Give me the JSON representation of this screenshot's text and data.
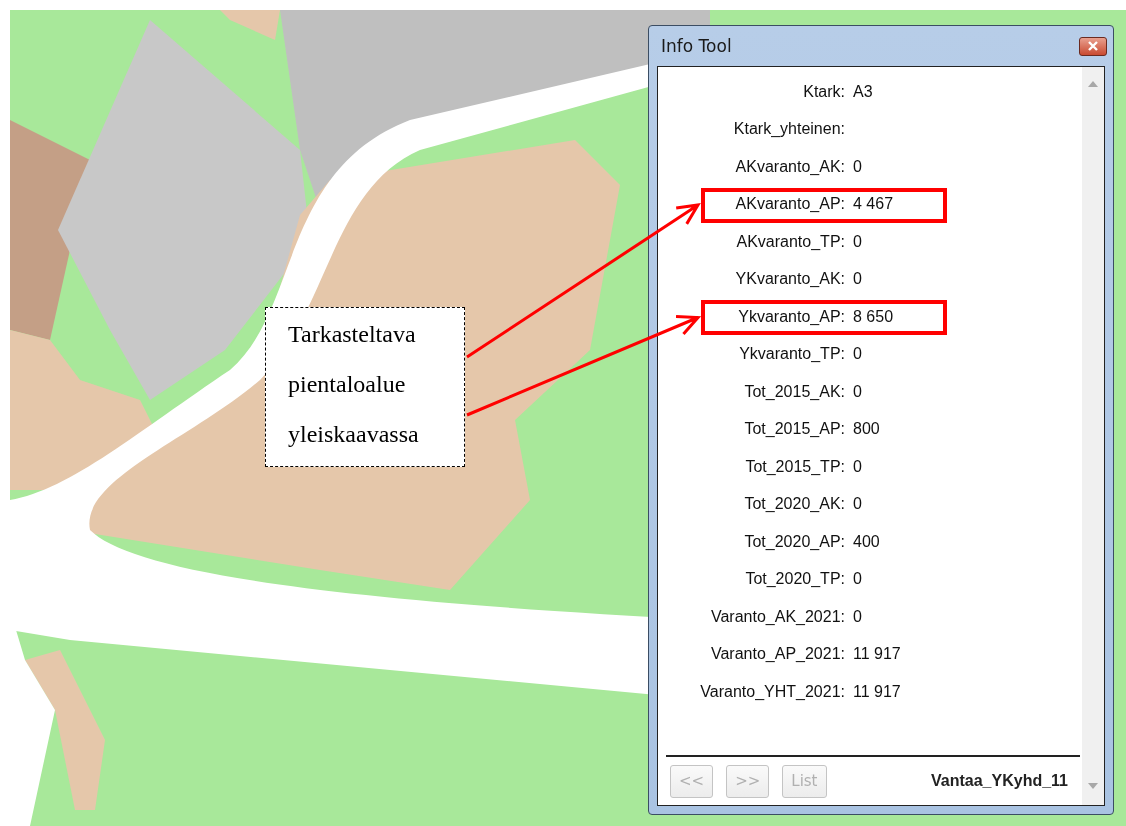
{
  "map_label": {
    "lines": [
      "Tarkasteltava",
      "pientaloalue",
      "yleiskaavassa"
    ]
  },
  "window": {
    "title": "Info Tool",
    "fields": [
      {
        "label": "Ktark:",
        "value": "A3",
        "highlighted": false
      },
      {
        "label": "Ktark_yhteinen:",
        "highlighted": false
      },
      {
        "label": "AKvaranto_AK:",
        "value": "0",
        "highlighted": false
      },
      {
        "label": "AKvaranto_AP:",
        "value": "4 467",
        "highlighted": true
      },
      {
        "label": "AKvaranto_TP:",
        "value": "0",
        "highlighted": false
      },
      {
        "label": "YKvaranto_AK:",
        "value": "0",
        "highlighted": false
      },
      {
        "label": "Ykvaranto_AP:",
        "value": "8 650",
        "highlighted": true
      },
      {
        "label": "Ykvaranto_TP:",
        "value": "0",
        "highlighted": false
      },
      {
        "label": "Tot_2015_AK:",
        "value": "0",
        "highlighted": false
      },
      {
        "label": "Tot_2015_AP:",
        "value": "800",
        "highlighted": false
      },
      {
        "label": "Tot_2015_TP:",
        "value": "0",
        "highlighted": false
      },
      {
        "label": "Tot_2020_AK:",
        "value": "0",
        "highlighted": false
      },
      {
        "label": "Tot_2020_AP:",
        "value": "400",
        "highlighted": false
      },
      {
        "label": "Tot_2020_TP:",
        "value": "0",
        "highlighted": false
      },
      {
        "label": "Varanto_AK_2021:",
        "value": "0",
        "highlighted": false
      },
      {
        "label": "Varanto_AP_2021:",
        "value": "11 917",
        "highlighted": false
      },
      {
        "label": "Varanto_YHT_2021:",
        "value": "11 917",
        "highlighted": false
      }
    ],
    "buttons": [
      {
        "label": "<<",
        "disabled": true
      },
      {
        "label": ">>",
        "disabled": true
      },
      {
        "label": "List",
        "disabled": true
      }
    ],
    "layer": "Vantaa_YKyhd_11"
  }
}
